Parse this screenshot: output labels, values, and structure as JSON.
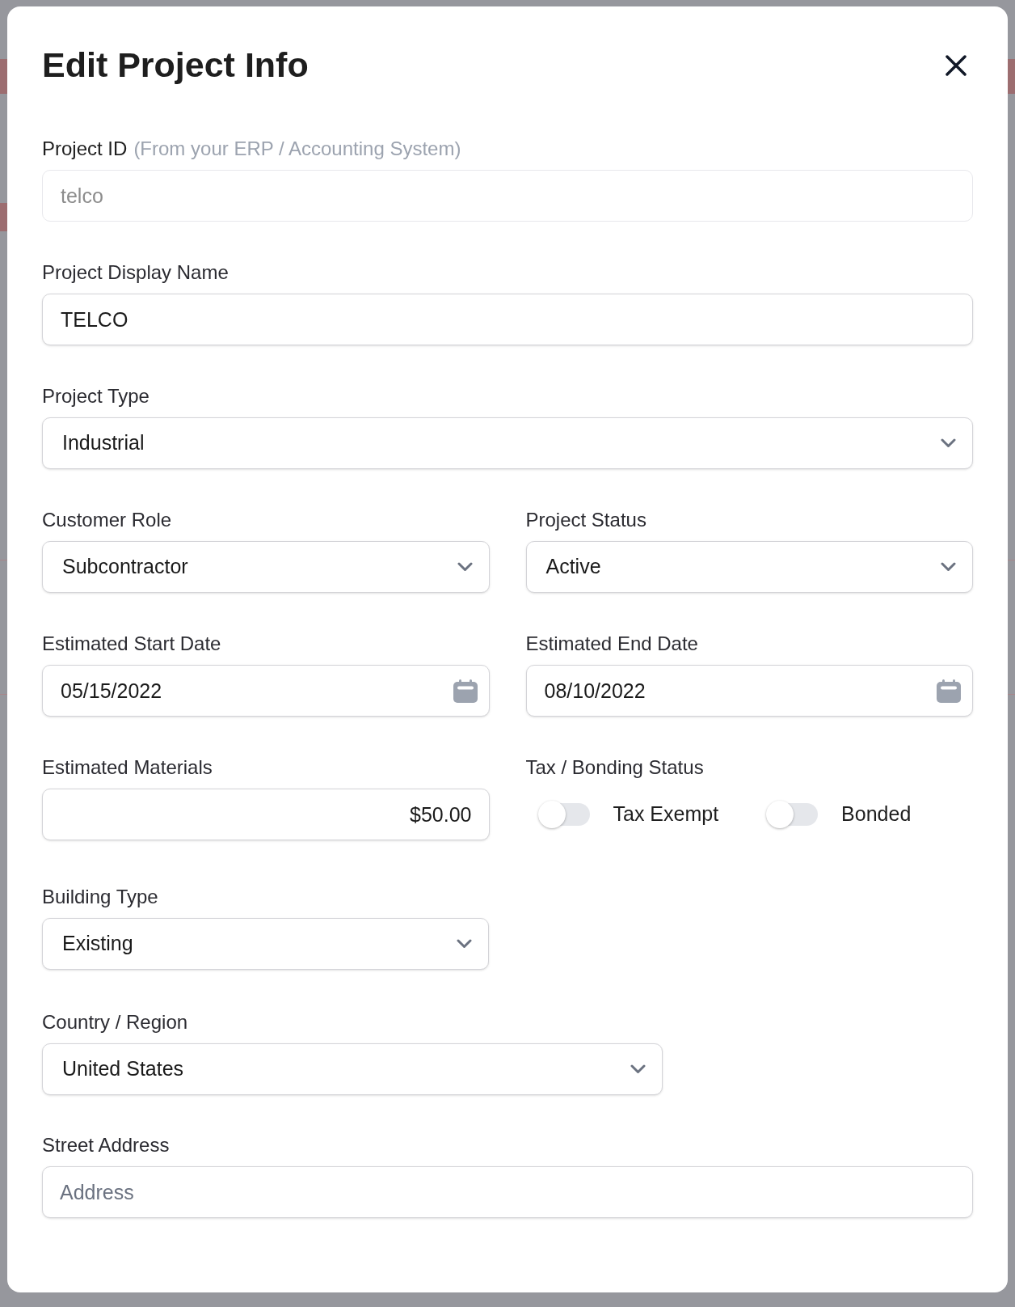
{
  "dialog": {
    "title": "Edit Project Info",
    "project_id": {
      "label": "Project ID",
      "hint": "(From your ERP / Accounting System)",
      "value": "telco",
      "disabled": true
    },
    "display_name": {
      "label": "Project Display Name",
      "value": "TELCO"
    },
    "project_type": {
      "label": "Project Type",
      "value": "Industrial"
    },
    "customer_role": {
      "label": "Customer Role",
      "value": "Subcontractor"
    },
    "project_status": {
      "label": "Project Status",
      "value": "Active"
    },
    "start_date": {
      "label": "Estimated Start Date",
      "value": "05/15/2022"
    },
    "end_date": {
      "label": "Estimated End Date",
      "value": "08/10/2022"
    },
    "estimated_materials": {
      "label": "Estimated Materials",
      "value": "$50.00"
    },
    "tax_bonding": {
      "label": "Tax / Bonding Status",
      "toggles": [
        {
          "label": "Tax Exempt",
          "on": false
        },
        {
          "label": "Bonded",
          "on": false
        }
      ]
    },
    "building_type": {
      "label": "Building Type",
      "value": "Existing"
    },
    "country_region": {
      "label": "Country / Region",
      "value": "United States"
    },
    "street_address": {
      "label": "Street Address",
      "placeholder": "Address"
    }
  }
}
